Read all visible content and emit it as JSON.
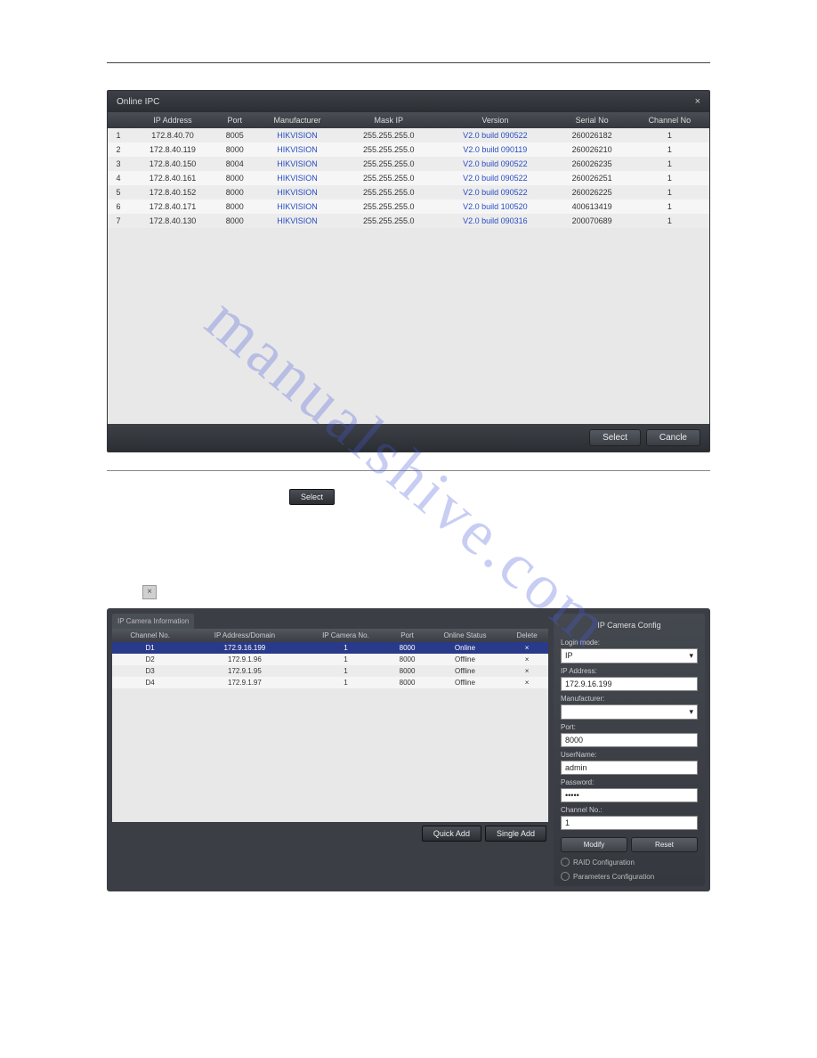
{
  "watermark": "manualshive.com",
  "dialog1": {
    "title": "Online IPC",
    "close": "×",
    "columns": [
      "",
      "IP Address",
      "Port",
      "Manufacturer",
      "Mask IP",
      "Version",
      "Serial No",
      "Channel No"
    ],
    "rows": [
      {
        "n": "1",
        "ip": "172.8.40.70",
        "port": "8005",
        "mfr": "HIKVISION",
        "mask": "255.255.255.0",
        "ver": "V2.0 build 090522",
        "serial": "260026182",
        "ch": "1"
      },
      {
        "n": "2",
        "ip": "172.8.40.119",
        "port": "8000",
        "mfr": "HIKVISION",
        "mask": "255.255.255.0",
        "ver": "V2.0 build 090119",
        "serial": "260026210",
        "ch": "1"
      },
      {
        "n": "3",
        "ip": "172.8.40.150",
        "port": "8004",
        "mfr": "HIKVISION",
        "mask": "255.255.255.0",
        "ver": "V2.0 build 090522",
        "serial": "260026235",
        "ch": "1"
      },
      {
        "n": "4",
        "ip": "172.8.40.161",
        "port": "8000",
        "mfr": "HIKVISION",
        "mask": "255.255.255.0",
        "ver": "V2.0 build 090522",
        "serial": "260026251",
        "ch": "1"
      },
      {
        "n": "5",
        "ip": "172.8.40.152",
        "port": "8000",
        "mfr": "HIKVISION",
        "mask": "255.255.255.0",
        "ver": "V2.0 build 090522",
        "serial": "260026225",
        "ch": "1"
      },
      {
        "n": "6",
        "ip": "172.8.40.171",
        "port": "8000",
        "mfr": "HIKVISION",
        "mask": "255.255.255.0",
        "ver": "V2.0 build 100520",
        "serial": "400613419",
        "ch": "1"
      },
      {
        "n": "7",
        "ip": "172.8.40.130",
        "port": "8000",
        "mfr": "HIKVISION",
        "mask": "255.255.255.0",
        "ver": "V2.0 build 090316",
        "serial": "200070689",
        "ch": "1"
      }
    ],
    "btn_select": "Select",
    "btn_cancel": "Cancle"
  },
  "inline_btn_select": "Select",
  "close_glyph": "×",
  "panel2": {
    "tab_title": "IP Camera Information",
    "columns": [
      "Channel No.",
      "IP Address/Domain",
      "IP Camera No.",
      "Port",
      "Online Status",
      "Delete"
    ],
    "rows": [
      {
        "ch": "D1",
        "ip": "172.9.16.199",
        "cam": "1",
        "port": "8000",
        "status": "Online",
        "del": "×"
      },
      {
        "ch": "D2",
        "ip": "172.9.1.96",
        "cam": "1",
        "port": "8000",
        "status": "Offline",
        "del": "×"
      },
      {
        "ch": "D3",
        "ip": "172.9.1.95",
        "cam": "1",
        "port": "8000",
        "status": "Offline",
        "del": "×"
      },
      {
        "ch": "D4",
        "ip": "172.9.1.97",
        "cam": "1",
        "port": "8000",
        "status": "Offline",
        "del": "×"
      }
    ],
    "btn_quick_add": "Quick Add",
    "btn_single_add": "Single Add",
    "config": {
      "title": "IP Camera Config",
      "login_mode_label": "Login mode:",
      "login_mode": "IP",
      "ip_label": "IP Address:",
      "ip": "172.9.16.199",
      "mfr_label": "Manufacturer:",
      "mfr": "",
      "port_label": "Port:",
      "port": "8000",
      "user_label": "UserName:",
      "user": "admin",
      "pass_label": "Password:",
      "pass": "•••••",
      "ch_label": "Channel No.:",
      "ch": "1",
      "btn_modify": "Modify",
      "btn_reset": "Reset",
      "link_raid": "RAID Configuration",
      "link_params": "Parameters Configuration"
    }
  }
}
